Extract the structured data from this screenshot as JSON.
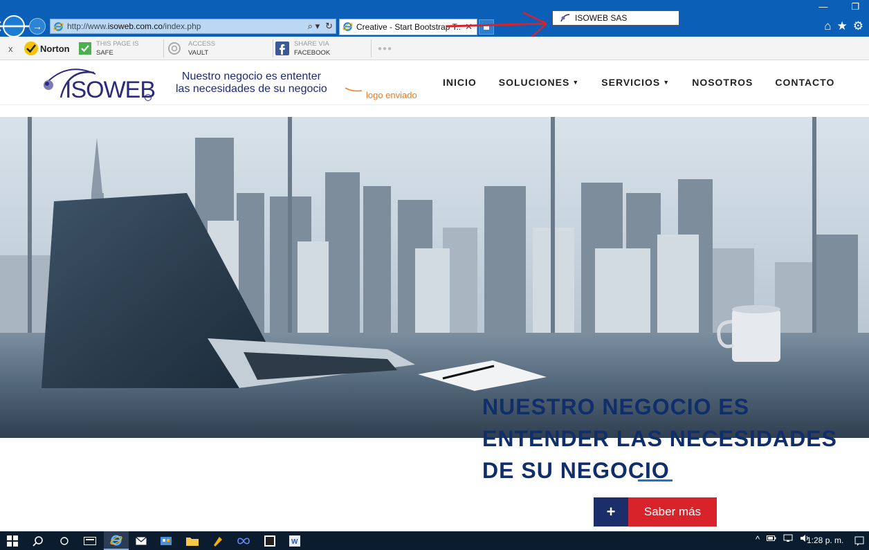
{
  "browser": {
    "back_glyph": "🡐",
    "forward_glyph": "→",
    "address_prefix": "http://www.",
    "address_domain": "isoweb.com.co",
    "address_path": "/index.php",
    "search_glyph": "⌕ ▾",
    "refresh_glyph": "↻",
    "tab_title": "Creative - Start Bootstrap T...",
    "tab_close": "✕",
    "tooltip_text": "ISOWEB SAS",
    "minimize_glyph": "—",
    "restore_glyph": "❐",
    "home_glyph": "⌂",
    "favorites_glyph": "★",
    "settings_glyph": "⚙"
  },
  "toolbar": {
    "close_glyph": "x",
    "norton_label": "Norton",
    "page_safe_top": "THIS PAGE IS",
    "page_safe_bottom": "SAFE",
    "access_top": "ACCESS",
    "access_bottom": "VAULT",
    "share_top": "SHARE VIA",
    "share_bottom": "FACEBOOK",
    "more_glyph": "●●●"
  },
  "site": {
    "logo_text": "ISOWEB",
    "tagline_line1": "Nuestro negocio es ententer",
    "tagline_line2": "las necesidades de su negocio",
    "annotation": "logo enviado",
    "nav": [
      {
        "label": "INICIO",
        "dropdown": false
      },
      {
        "label": "SOLUCIONES",
        "dropdown": true
      },
      {
        "label": "SERVICIOS",
        "dropdown": true
      },
      {
        "label": "NOSOTROS",
        "dropdown": false
      },
      {
        "label": "CONTACTO",
        "dropdown": false
      }
    ],
    "hero_line1": "NUESTRO NEGOCIO ES",
    "hero_line2": "ENTENDER LAS NECESIDADES",
    "hero_line3": "DE SU NEGOCIO",
    "cta_plus": "+",
    "cta_label": "Saber más"
  },
  "taskbar": {
    "clock": "1:28 p. m.",
    "tray_up": "^"
  },
  "colors": {
    "chrome_blue": "#0b5fb7",
    "brand_navy": "#0f2e6a",
    "cta_red": "#d8232a",
    "annotation_orange": "#f07a1a"
  }
}
